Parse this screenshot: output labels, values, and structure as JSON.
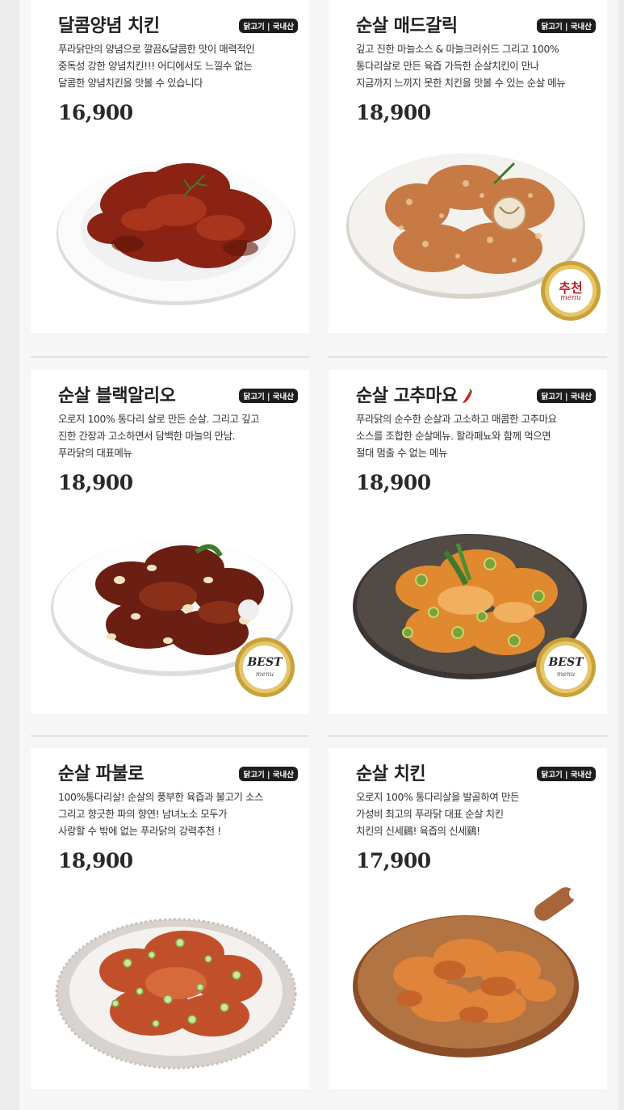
{
  "menu": [
    {
      "name": "달콤양념 치킨",
      "badge": "닭고기 | 국내산",
      "desc": [
        "푸라닭만의 양념으로 깔끔&달콤한 맛이 매력적인",
        "중독성 강한 양념치킨!!! 어디에서도 느낄수 없는",
        "달콤한 양념치킨을 맛볼 수 있습니다"
      ],
      "price": "16,900"
    },
    {
      "name": "순살 매드갈릭",
      "badge": "닭고기 | 국내산",
      "desc": [
        "깊고 진한 마늘소스 & 마늘크러쉬드 그리고 100%",
        "통다리살로 만든 육즙 가득한 순살치킨이 만나",
        "지금까지 느끼지 못한 치킨을 맛볼 수 있는 순살 메뉴"
      ],
      "price": "18,900",
      "seal": {
        "main": "추천",
        "sub": "menu"
      }
    },
    {
      "name": "순살 블랙알리오",
      "badge": "닭고기 | 국내산",
      "desc": [
        "오로지 100% 통다리 살로 만든 순살. 그리고 깊고",
        "진한 간장과 고소하면서 담백한 마늘의 만남.",
        "푸라닭의 대표메뉴"
      ],
      "price": "18,900",
      "seal": {
        "main": "BEST",
        "sub": "menu"
      }
    },
    {
      "name": "순살 고추마요",
      "badge": "닭고기 | 국내산",
      "desc": [
        "푸라닭의 순수한 순살과 고소하고 매콤한 고추마요",
        "소스를 조합한 순살메뉴. 할라페뇨와 함께 먹으면",
        "절대 멈출 수 없는 메뉴"
      ],
      "price": "18,900",
      "seal": {
        "main": "BEST",
        "sub": "menu"
      }
    },
    {
      "name": "순살 파불로",
      "badge": "닭고기 | 국내산",
      "desc": [
        "100%통다리살! 순살의 풍부한 육즙과 불고기 소스",
        "그리고 향긋한 파의 향연! 남녀노소 모두가",
        "사랑할 수 밖에 없는 푸라닭의 강력추천 !"
      ],
      "price": "18,900"
    },
    {
      "name": "순살 치킨",
      "badge": "닭고기 | 국내산",
      "desc": [
        "오로지 100% 통다리살을 발골하여 만든",
        "가성비 최고의 푸라닭 대표 순살 치킨",
        "치킨의 신세鷄! 육즙의 신세鷄!"
      ],
      "price": "17,900"
    }
  ],
  "colors": {
    "badge_bg": "#1d1d1d",
    "seal_gold": "#c9a13a",
    "seal_red": "#b5222b"
  }
}
